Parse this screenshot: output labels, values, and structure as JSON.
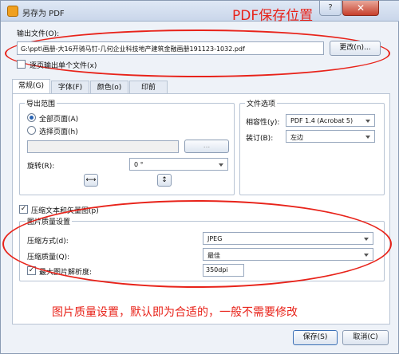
{
  "window": {
    "title": "另存为 PDF",
    "help": "?",
    "close": "✕"
  },
  "annotations": {
    "top": "PDF保存位置",
    "bottom": "图片质量设置，默认即为合适的，一般不需要修改",
    "color": "#e8231a"
  },
  "output": {
    "label": "输出文件(O):",
    "path": "G:\\ppt\\画册-大16开骑马钉-几何企业科技地产建筑金融画册191123-1032.pdf",
    "browse_button": "更改(n)...",
    "per_page_checkbox": "逐页输出单个文件(x)"
  },
  "tabs": [
    "常规(G)",
    "字体(F)",
    "颜色(o)",
    "印前"
  ],
  "export_range": {
    "title": "导出范围",
    "all_pages": "全部页面(A)",
    "choose_pages": "选择页面(h)",
    "pages_value": "",
    "pages_button": "...",
    "rotate_label": "旋转(R):",
    "rotate_value": "0 °"
  },
  "file_options": {
    "title": "文件选项",
    "compat_label": "相容性(y):",
    "compat_value": "PDF 1.4 (Acrobat 5)",
    "binding_label": "装订(B):",
    "binding_value": "左边"
  },
  "compress_text_checkbox": "压缩文本和矢量图(p)",
  "image_quality": {
    "title": "图片质量设置",
    "method_label": "压缩方式(d):",
    "method_value": "JPEG",
    "quality_label": "压缩质量(Q):",
    "quality_value": "最佳",
    "max_res_label": "最大图片解析度:",
    "max_res_value": "350dpi"
  },
  "footer": {
    "save_button": "保存(S)",
    "cancel_button": "取消(C)"
  }
}
